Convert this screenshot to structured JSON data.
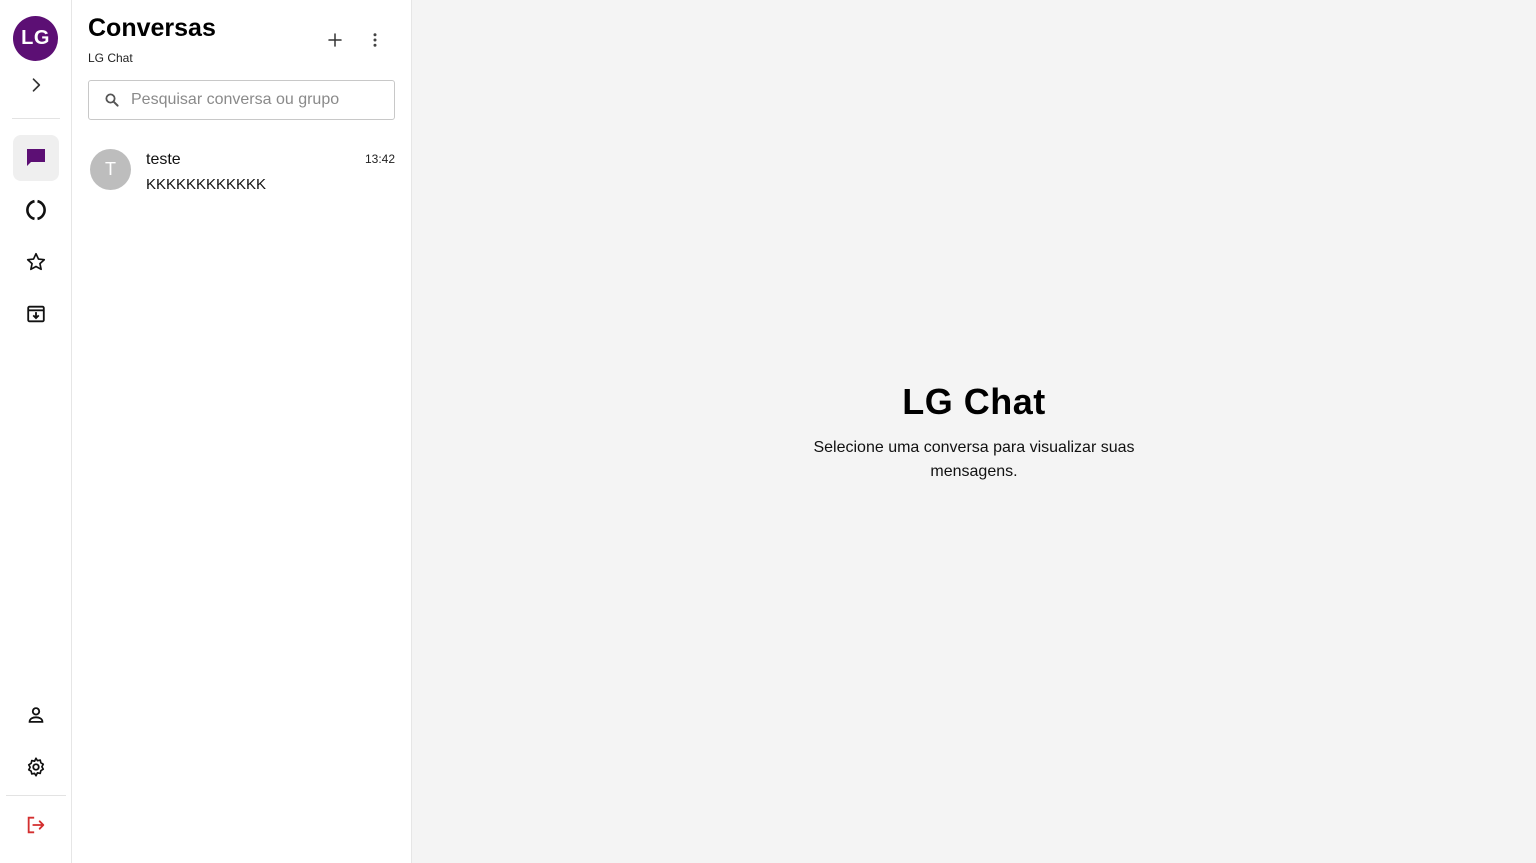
{
  "rail": {
    "avatar_initials": "LG",
    "brand_color": "#5c0f74",
    "icons": {
      "expand": "chevron-right-icon",
      "chats": "chat-icon",
      "status": "status-ring-icon",
      "starred": "star-icon",
      "archived": "archive-icon",
      "profile": "person-icon",
      "settings": "gear-icon",
      "logout": "logout-icon"
    },
    "logout_color": "#d32f2f"
  },
  "panel": {
    "title": "Conversas",
    "subtitle": "LG Chat",
    "search": {
      "placeholder": "Pesquisar conversa ou grupo",
      "value": ""
    },
    "conversations": [
      {
        "initial": "T",
        "name": "teste",
        "preview": "KKKKKKKKKKKK",
        "time": "13:42"
      }
    ]
  },
  "main": {
    "title": "LG Chat",
    "message": "Selecione uma conversa para visualizar suas mensagens."
  }
}
